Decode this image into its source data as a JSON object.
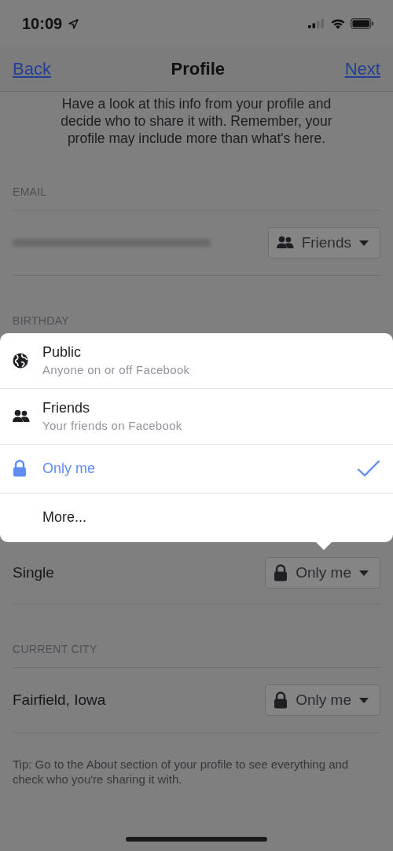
{
  "status_bar": {
    "time": "10:09"
  },
  "nav": {
    "back": "Back",
    "title": "Profile",
    "next": "Next"
  },
  "intro": "Have a look at this info from your profile and decide who to share it with. Remember, your profile may include more than what's here.",
  "blocks": [
    {
      "kind": "header",
      "text": "EMAIL"
    },
    {
      "kind": "row",
      "redacted": true,
      "audience": {
        "label": "Friends",
        "kind": "friends"
      }
    },
    {
      "kind": "header",
      "text": "BIRTHDAY"
    },
    {
      "kind": "menu",
      "options": [
        {
          "label": "Public",
          "subtitle": "Anyone on or off Facebook",
          "kind": "globe",
          "selected": false
        },
        {
          "label": "Friends",
          "subtitle": "Your friends on Facebook",
          "kind": "friends",
          "selected": false
        },
        {
          "label": "Only me",
          "kind": "lock",
          "selected": true
        },
        {
          "label": "More...",
          "selected": false
        }
      ]
    },
    {
      "kind": "row",
      "value": "Single",
      "audience": {
        "label": "Only me",
        "kind": "lock"
      }
    },
    {
      "kind": "header",
      "text": "CURRENT CITY"
    },
    {
      "kind": "row",
      "value": "Fairfield, Iowa",
      "audience": {
        "label": "Only me",
        "kind": "lock"
      }
    },
    {
      "kind": "tip",
      "text": "Tip: Go to the About section of your profile to see everything and check who you're sharing it with."
    }
  ]
}
